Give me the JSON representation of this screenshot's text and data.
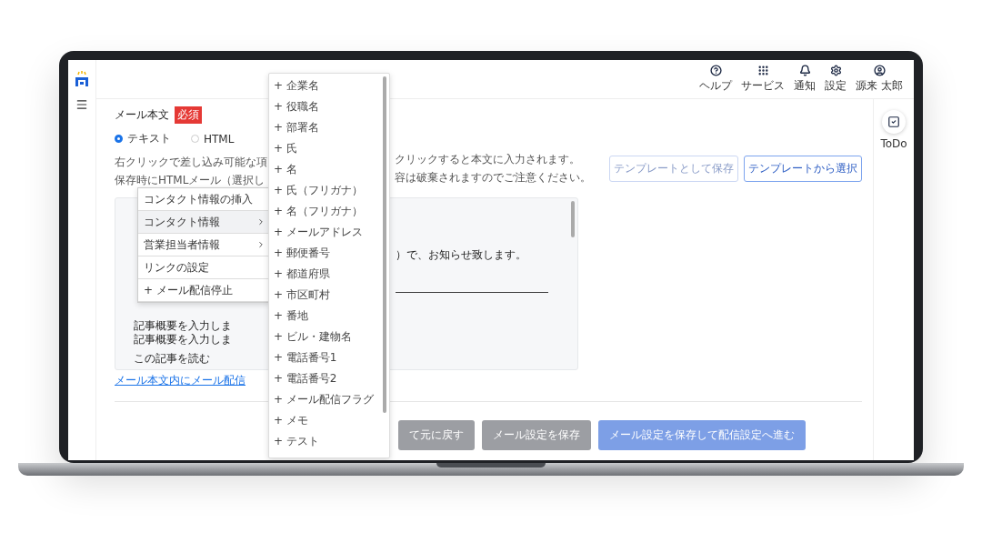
{
  "header": {
    "actions": [
      {
        "kind": "help",
        "label": "ヘルプ"
      },
      {
        "kind": "services",
        "label": "サービス"
      },
      {
        "kind": "notifications",
        "label": "通知"
      },
      {
        "kind": "settings",
        "label": "設定"
      },
      {
        "kind": "user",
        "label": "源来 太郎"
      }
    ]
  },
  "right_rail": {
    "todo_label": "ToDo"
  },
  "form": {
    "title": "メール本文",
    "required_badge": "必須",
    "radios": [
      {
        "label": "テキスト",
        "selected": true
      },
      {
        "label": "HTML",
        "selected": false
      }
    ],
    "help_lines": [
      {
        "left": "右クリックで差し込み可能な項",
        "right": "クリックすると本文に入力されます。"
      },
      {
        "left": "保存時にHTMLメール（選択し",
        "right": "容は破棄されますのでご注意ください。"
      }
    ],
    "template_buttons": [
      {
        "label": "テンプレートとして保存",
        "disabled": true
      },
      {
        "label": "テンプレートから選択",
        "disabled": false
      }
    ],
    "editor": {
      "right_lines": [
        "）で、お知らせ致します。",
        "――――――――――――――"
      ],
      "left_lines": [
        "記事概要を入力しま",
        "記事概要を入力しま",
        "この記事を読む"
      ]
    },
    "link": "メール本文内にメール配信",
    "action_buttons": [
      {
        "label": "て元に戻す",
        "kind": "secondary"
      },
      {
        "label": "メール設定を保存",
        "kind": "secondary"
      },
      {
        "label": "メール設定を保存して配信設定へ進む",
        "kind": "primary"
      }
    ]
  },
  "context_menu": {
    "items": [
      {
        "label": "コンタクト情報の挿入",
        "submenu": false,
        "highlighted": false
      },
      {
        "label": "コンタクト情報",
        "submenu": true,
        "highlighted": true
      },
      {
        "label": "営業担当者情報",
        "submenu": true,
        "highlighted": false
      },
      {
        "label": "リンクの設定",
        "submenu": false,
        "highlighted": false
      },
      {
        "label": "+ メール配信停止",
        "submenu": false,
        "highlighted": false
      }
    ]
  },
  "field_dropdown": {
    "items": [
      "+ 企業名",
      "+ 役職名",
      "+ 部署名",
      "+ 氏",
      "+ 名",
      "+ 氏（フリガナ）",
      "+ 名（フリガナ）",
      "+ メールアドレス",
      "+ 郵便番号",
      "+ 都道府県",
      "+ 市区町村",
      "+ 番地",
      "+ ビル・建物名",
      "+ 電話番号1",
      "+ 電話番号2",
      "+ メール配信フラグ",
      "+ メモ",
      "+ テスト"
    ]
  }
}
